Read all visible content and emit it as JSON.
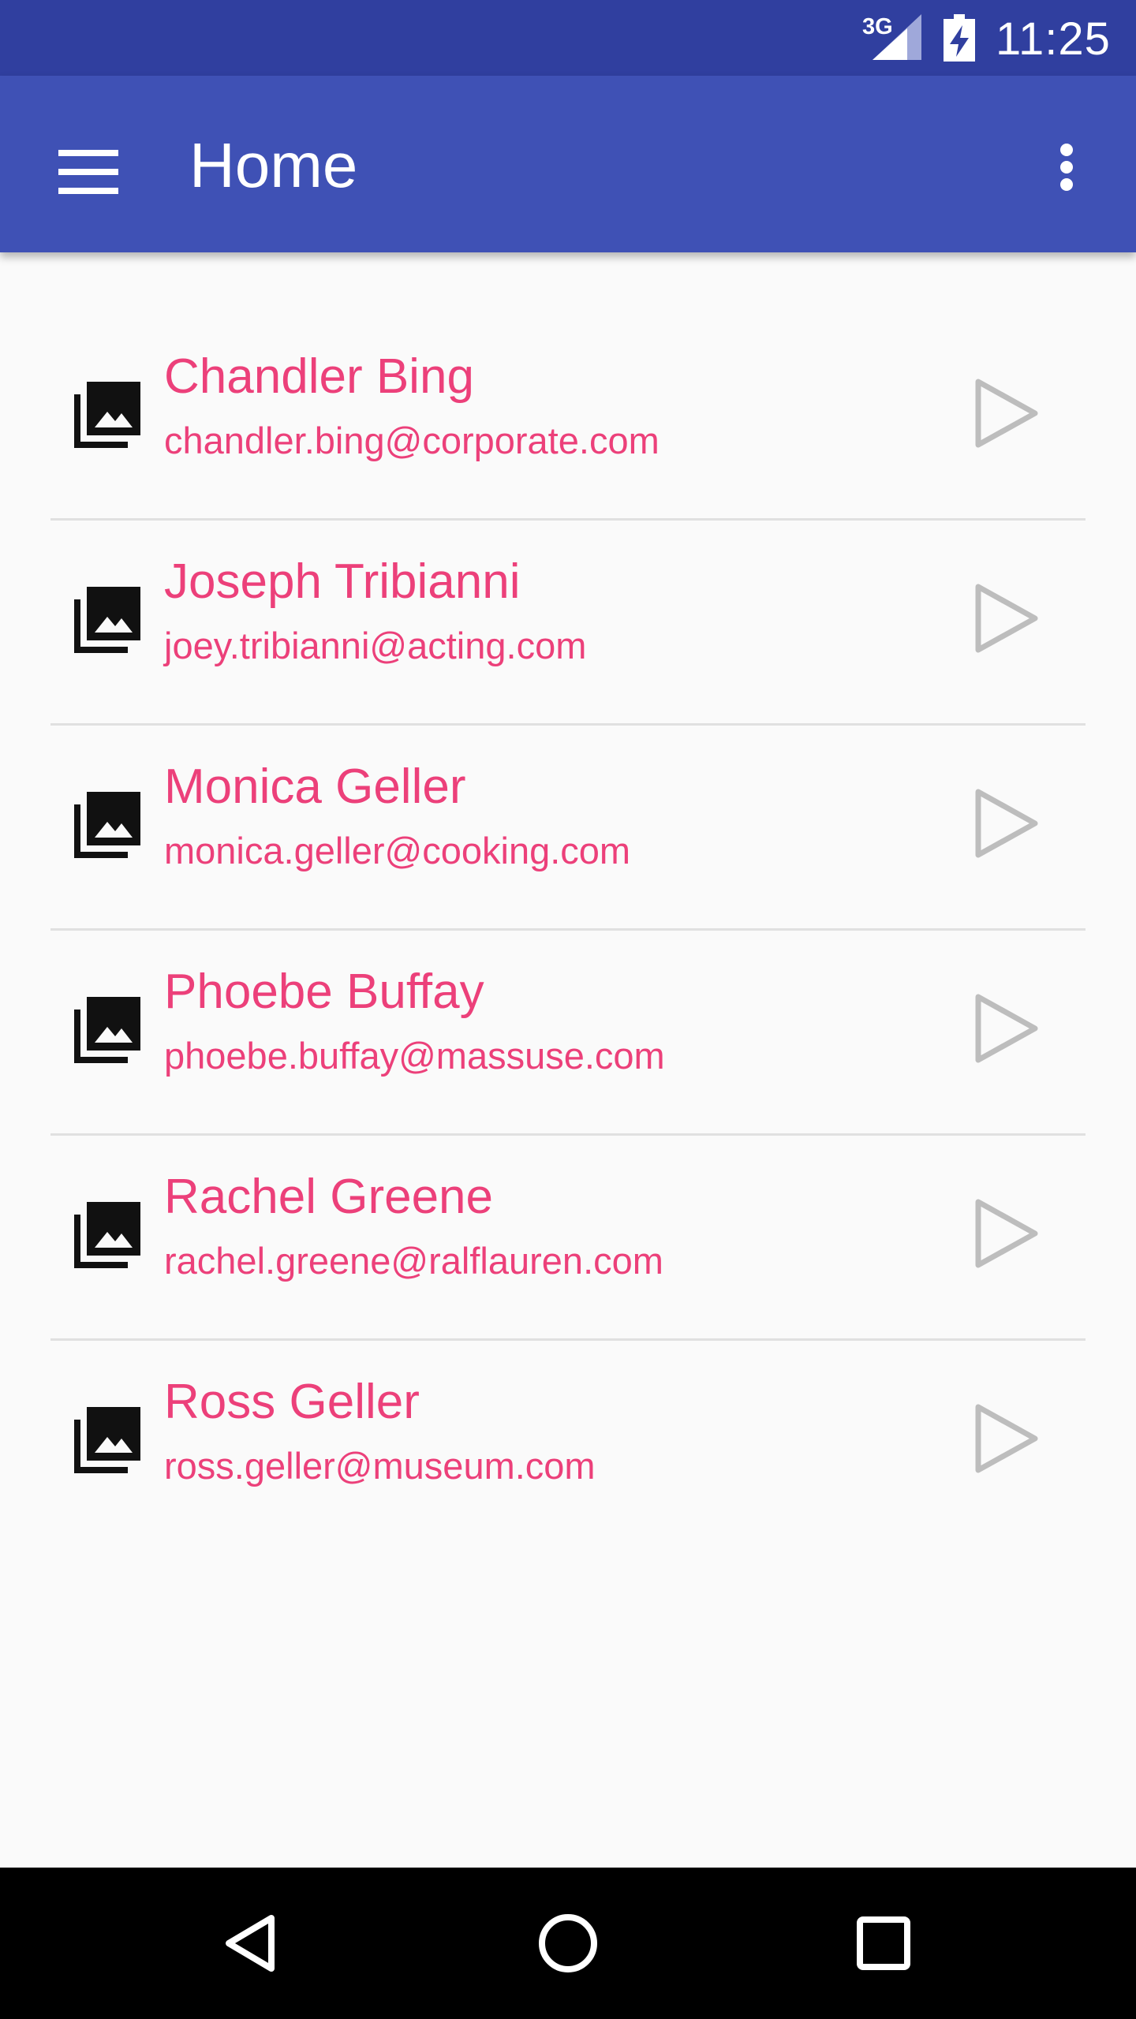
{
  "status_bar": {
    "network_type": "3G",
    "time": "11:25"
  },
  "app_bar": {
    "title": "Home"
  },
  "colors": {
    "status_bar": "#303F9F",
    "app_bar": "#3F51B5",
    "accent_text": "#EC407A",
    "play_icon": "#BDBDBD",
    "thumb_icon": "#111111"
  },
  "contacts": [
    {
      "name": "Chandler Bing",
      "email": "chandler.bing@corporate.com"
    },
    {
      "name": "Joseph Tribianni",
      "email": "joey.tribianni@acting.com"
    },
    {
      "name": "Monica Geller",
      "email": "monica.geller@cooking.com"
    },
    {
      "name": "Phoebe Buffay",
      "email": "phoebe.buffay@massuse.com"
    },
    {
      "name": "Rachel Greene",
      "email": "rachel.greene@ralflauren.com"
    },
    {
      "name": "Ross Geller",
      "email": "ross.geller@museum.com"
    }
  ],
  "icons": {
    "menu": "hamburger-menu-icon",
    "overflow": "more-vert-icon",
    "thumb": "photo-library-icon",
    "play": "play-outline-icon",
    "back": "nav-back-icon",
    "home": "nav-home-icon",
    "recents": "nav-recents-icon"
  }
}
